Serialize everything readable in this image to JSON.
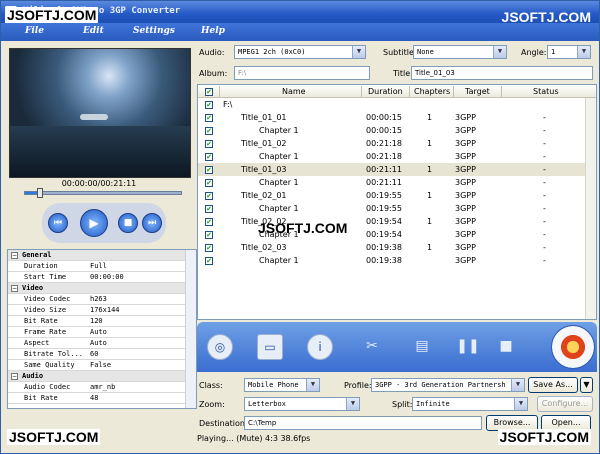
{
  "window": {
    "title": "Xilisoft DVD to 3GP Converter"
  },
  "watermarks": {
    "top_left": "JSOFTJ.COM",
    "top_right": "JSOFTJ.COM",
    "middle": "JSOFTJ.COM",
    "bottom_left": "JSOFTJ.COM",
    "bottom_right": "JSOFTJ.COM"
  },
  "menu": {
    "file": "File",
    "edit": "Edit",
    "settings": "Settings",
    "help": "Help"
  },
  "player": {
    "time": "00:00:00/00:21:11",
    "progress": 0.1
  },
  "properties": [
    {
      "group": true,
      "k": "General",
      "expanded": true
    },
    {
      "k": "Duration",
      "v": "Full"
    },
    {
      "k": "Start Time",
      "v": "00:00:00"
    },
    {
      "group": true,
      "k": "Video",
      "expanded": true
    },
    {
      "k": "Video Codec",
      "v": "h263"
    },
    {
      "k": "Video Size",
      "v": "176x144"
    },
    {
      "k": "Bit Rate",
      "v": "120"
    },
    {
      "k": "Frame Rate",
      "v": "Auto"
    },
    {
      "k": "Aspect",
      "v": "Auto"
    },
    {
      "k": "Bitrate Tol...",
      "v": "60"
    },
    {
      "k": "Same Quality",
      "v": "False"
    },
    {
      "group": true,
      "k": "Audio",
      "expanded": true
    },
    {
      "k": "Audio Codec",
      "v": "amr_nb"
    },
    {
      "k": "Bit Rate",
      "v": "48"
    }
  ],
  "audio": {
    "label": "Audio:",
    "value": "MPEG1 2ch (0xC0)"
  },
  "subtitle": {
    "label": "Subtitle:",
    "value": "None"
  },
  "angle": {
    "label": "Angle:",
    "value": "1"
  },
  "album": {
    "label": "Album:",
    "placeholder": "F:\\"
  },
  "title_field": {
    "label": "Title:",
    "value": "Title_01_03"
  },
  "list": {
    "headers": {
      "name": "Name",
      "duration": "Duration",
      "chapters": "Chapters",
      "target": "Target",
      "status": "Status"
    },
    "root": "F:\\",
    "rows": [
      {
        "name": "Title_01_01",
        "level": 1,
        "duration": "00:00:15",
        "chapters": "1",
        "target": "3GPP",
        "status": "-",
        "checked": true
      },
      {
        "name": "Chapter 1",
        "level": 2,
        "duration": "00:00:15",
        "chapters": "",
        "target": "3GPP",
        "status": "-",
        "checked": true
      },
      {
        "name": "Title_01_02",
        "level": 1,
        "duration": "00:21:18",
        "chapters": "1",
        "target": "3GPP",
        "status": "-",
        "checked": true
      },
      {
        "name": "Chapter 1",
        "level": 2,
        "duration": "00:21:18",
        "chapters": "",
        "target": "3GPP",
        "status": "-",
        "checked": true
      },
      {
        "name": "Title_01_03",
        "level": 1,
        "duration": "00:21:11",
        "chapters": "1",
        "target": "3GPP",
        "status": "-",
        "checked": true,
        "selected": true
      },
      {
        "name": "Chapter 1",
        "level": 2,
        "duration": "00:21:11",
        "chapters": "",
        "target": "3GPP",
        "status": "-",
        "checked": true
      },
      {
        "name": "Title_02_01",
        "level": 1,
        "duration": "00:19:55",
        "chapters": "1",
        "target": "3GPP",
        "status": "-",
        "checked": true
      },
      {
        "name": "Chapter 1",
        "level": 2,
        "duration": "00:19:55",
        "chapters": "",
        "target": "3GPP",
        "status": "-",
        "checked": true
      },
      {
        "name": "Title_02_02",
        "level": 1,
        "duration": "00:19:54",
        "chapters": "1",
        "target": "3GPP",
        "status": "-",
        "checked": true
      },
      {
        "name": "Chapter 1",
        "level": 2,
        "duration": "00:19:54",
        "chapters": "",
        "target": "3GPP",
        "status": "-",
        "checked": true
      },
      {
        "name": "Title_02_03",
        "level": 1,
        "duration": "00:19:38",
        "chapters": "1",
        "target": "3GPP",
        "status": "-",
        "checked": true
      },
      {
        "name": "Chapter 1",
        "level": 2,
        "duration": "00:19:38",
        "chapters": "",
        "target": "3GPP",
        "status": "-",
        "checked": true
      }
    ]
  },
  "profile_class": {
    "label": "Class:",
    "value": "Mobile Phone"
  },
  "profile": {
    "label": "Profile:",
    "value": "3GPP - 3rd Generation Partnersh"
  },
  "save_as": "Save As...",
  "zoom": {
    "label": "Zoom:",
    "value": "Letterbox"
  },
  "split": {
    "label": "Split:",
    "value": "Infinite"
  },
  "configure": "Configure...",
  "destination": {
    "label": "Destination:",
    "value": "C:\\Temp"
  },
  "browse": "Browse...",
  "open": "Open...",
  "status": "Playing... (Mute) 4:3   38.6fps"
}
